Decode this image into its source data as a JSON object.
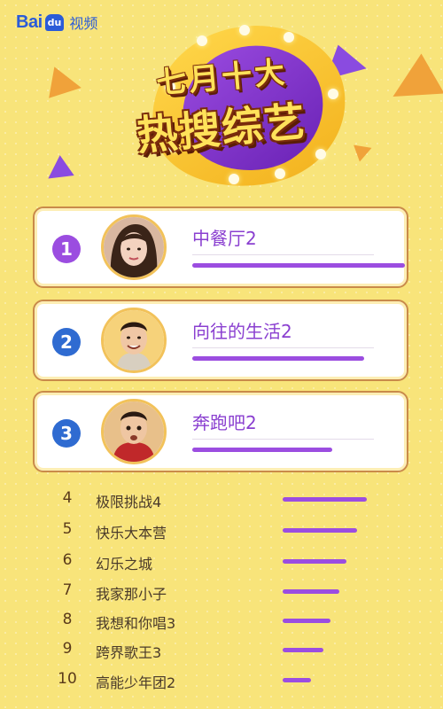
{
  "logo": {
    "bai": "Bai",
    "du": "du",
    "video": "视频"
  },
  "header": {
    "line1": "七月十大",
    "line2": "热搜综艺"
  },
  "top3": [
    {
      "rank": "1",
      "name": "中餐厅2",
      "color": "#9b4de0",
      "level": 0.94
    },
    {
      "rank": "2",
      "name": "向往的生活2",
      "color": "#2f6bd1",
      "level": 0.76
    },
    {
      "rank": "3",
      "name": "奔跑吧2",
      "color": "#2f6bd1",
      "level": 0.62
    }
  ],
  "list": [
    {
      "rank": "4",
      "name": "极限挑战4",
      "level": 0.95
    },
    {
      "rank": "5",
      "name": "快乐大本营",
      "level": 0.84
    },
    {
      "rank": "6",
      "name": "幻乐之城",
      "level": 0.72
    },
    {
      "rank": "7",
      "name": "我家那小子",
      "level": 0.64
    },
    {
      "rank": "8",
      "name": "我想和你唱3",
      "level": 0.54
    },
    {
      "rank": "9",
      "name": "跨界歌王3",
      "level": 0.46
    },
    {
      "rank": "10",
      "name": "高能少年团2",
      "level": 0.32
    }
  ]
}
